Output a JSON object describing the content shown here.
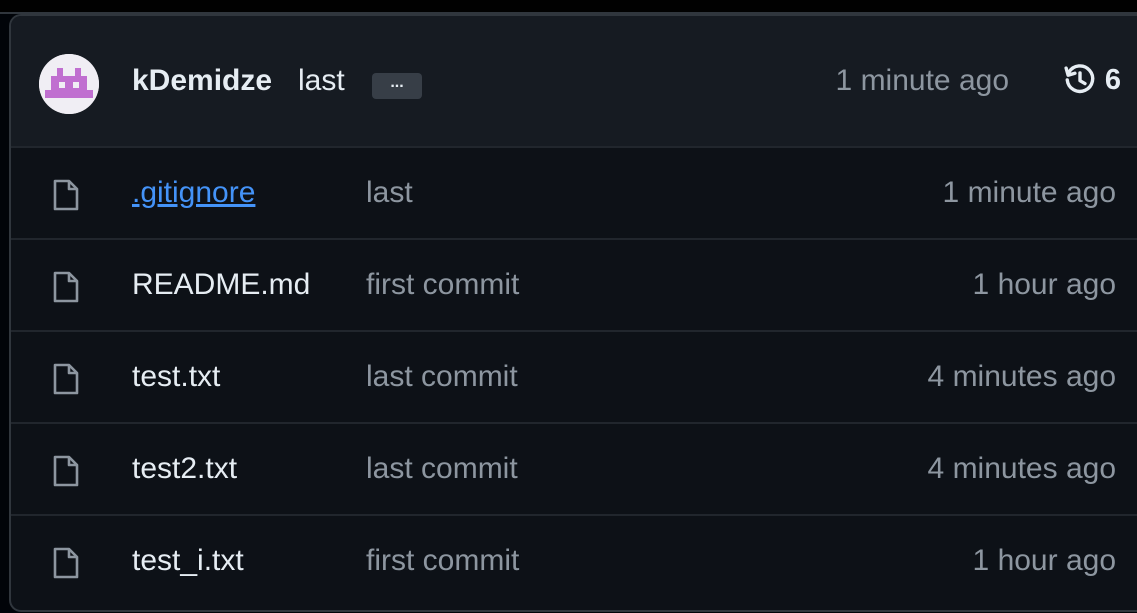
{
  "colors": {
    "background": "#0d1117",
    "header_background": "#161b22",
    "border": "#30363d",
    "text_primary": "#e6edf3",
    "text_muted": "#8d96a0",
    "link": "#4493f8",
    "avatar_accent": "#c06fd0"
  },
  "latest_commit": {
    "author": "kDemidze",
    "message": "last",
    "ellipsis_label": "...",
    "time": "1 minute ago",
    "history_icon": "history-icon",
    "history_count": "6"
  },
  "files": [
    {
      "name": ".gitignore",
      "message": "last",
      "time": "1 minute ago",
      "icon": "file-icon",
      "hovered": true
    },
    {
      "name": "README.md",
      "message": "first commit",
      "time": "1 hour ago",
      "icon": "file-icon",
      "hovered": false
    },
    {
      "name": "test.txt",
      "message": "last commit",
      "time": "4 minutes ago",
      "icon": "file-icon",
      "hovered": false
    },
    {
      "name": "test2.txt",
      "message": "last commit",
      "time": "4 minutes ago",
      "icon": "file-icon",
      "hovered": false
    },
    {
      "name": "test_i.txt",
      "message": "first commit",
      "time": "1 hour ago",
      "icon": "file-icon",
      "hovered": false
    }
  ]
}
